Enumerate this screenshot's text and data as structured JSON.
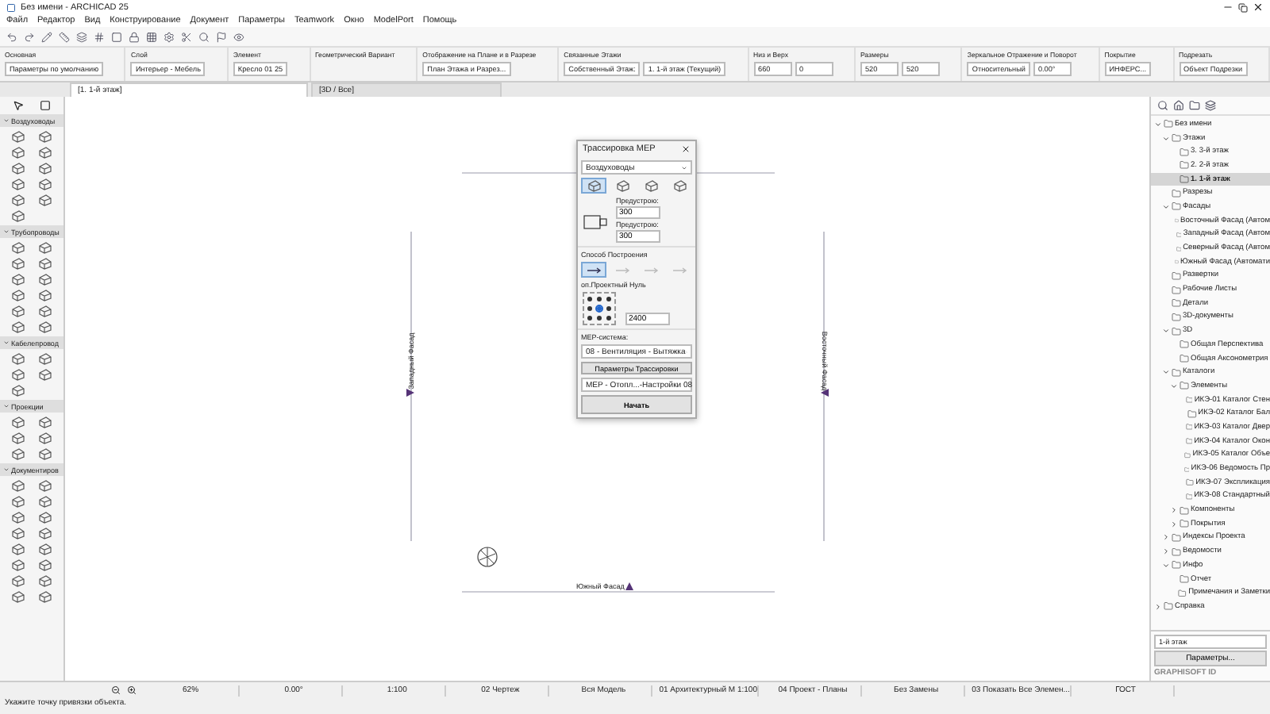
{
  "window": {
    "title": "Без имени - ARCHICAD 25"
  },
  "menu": [
    "Файл",
    "Редактор",
    "Вид",
    "Конструирование",
    "Документ",
    "Параметры",
    "Teamwork",
    "Окно",
    "ModelPort",
    "Помощь"
  ],
  "info_box": [
    {
      "label": "Основная",
      "values": [
        "Параметры по умолчанию"
      ]
    },
    {
      "label": "Слой",
      "values": [
        "Интерьер - Мебель"
      ]
    },
    {
      "label": "Элемент",
      "values": [
        "Кресло 01 25"
      ]
    },
    {
      "label": "Геометрический Вариант"
    },
    {
      "label": "Отображение на Плане и в Разрезе",
      "values": [
        "План Этажа и Разрез..."
      ]
    },
    {
      "label": "Связанные Этажи",
      "values": [
        "Собственный Этаж:",
        "1. 1-й этаж (Текущий)"
      ]
    },
    {
      "label": "Низ и Верх",
      "values": [
        "660",
        "0"
      ]
    },
    {
      "label": "Размеры",
      "values": [
        "520",
        "520"
      ]
    },
    {
      "label": "Зеркальное Отражение и Поворот",
      "values": [
        "Относительный",
        "0.00°"
      ]
    },
    {
      "label": "Покрытие",
      "values": [
        "ИНФЕРС..."
      ]
    },
    {
      "label": "Подрезать",
      "values": [
        "Объект Подрезки"
      ]
    }
  ],
  "tabs": [
    {
      "label": "[1. 1-й этаж]",
      "selected": true
    },
    {
      "label": "[3D / Все]",
      "selected": false
    }
  ],
  "toolbox": [
    {
      "title": "Воздуховоды",
      "expanded": true
    },
    {
      "title": "Трубопроводы",
      "expanded": true
    },
    {
      "title": "Кабелепровод",
      "expanded": true
    },
    {
      "title": "Проекции",
      "expanded": true
    },
    {
      "title": "Документиров",
      "expanded": true
    }
  ],
  "canvas": {
    "markers": [
      "Западный Фасад",
      "Восточный Фасад",
      "Южный Фасад"
    ]
  },
  "mep_dialog": {
    "title": "Трассировка MEP",
    "category": "Воздуховоды",
    "shapes": [
      {
        "selected": true
      },
      {
        "selected": false
      },
      {
        "selected": false
      },
      {
        "selected": false
      }
    ],
    "width_label": "Предустрою:",
    "width_value": "300",
    "height_label": "Предустрою:",
    "height_value": "300",
    "method_label": "Способ Построения",
    "methods": [
      {
        "selected": true,
        "disabled": false
      },
      {
        "selected": false,
        "disabled": true
      },
      {
        "selected": false,
        "disabled": true
      },
      {
        "selected": false,
        "disabled": true
      }
    ],
    "anchor_label": "оп.Проектный Нуль",
    "anchors": [
      {
        "selected": false
      },
      {
        "selected": false
      },
      {
        "selected": false
      },
      {
        "selected": false
      },
      {
        "selected": true
      },
      {
        "selected": false
      },
      {
        "selected": false
      },
      {
        "selected": false
      },
      {
        "selected": false
      }
    ],
    "elevation_value": "2400",
    "system_label": "MEP-система:",
    "system_value": "08 - Вентиляция - Вытяжка",
    "settings_button": "Параметры Трассировки",
    "preset_value": "MEP - Отопл...-Настройки 08",
    "start_button": "Начать"
  },
  "navigator": [
    {
      "label": "Без имени",
      "expanded": true,
      "selected": false,
      "children": [
        {
          "label": "Этажи",
          "expanded": true,
          "selected": false,
          "children": [
            {
              "label": "3. 3-й этаж",
              "selected": false
            },
            {
              "label": "2. 2-й этаж",
              "selected": false
            },
            {
              "label": "1. 1-й этаж",
              "selected": true
            }
          ]
        },
        {
          "label": "Разрезы",
          "selected": false
        },
        {
          "label": "Фасады",
          "expanded": true,
          "selected": false,
          "children": [
            {
              "label": "Восточный Фасад (Автом",
              "selected": false
            },
            {
              "label": "Западный Фасад (Автом",
              "selected": false
            },
            {
              "label": "Северный Фасад (Автом",
              "selected": false
            },
            {
              "label": "Южный Фасад (Автомати",
              "selected": false
            }
          ]
        },
        {
          "label": "Развертки",
          "selected": false
        },
        {
          "label": "Рабочие Листы",
          "selected": false
        },
        {
          "label": "Детали",
          "selected": false
        },
        {
          "label": "3D-документы",
          "selected": false
        },
        {
          "label": "3D",
          "expanded": true,
          "selected": false,
          "children": [
            {
              "label": "Общая Перспектива",
              "selected": false
            },
            {
              "label": "Общая Аксонометрия",
              "selected": false
            }
          ]
        },
        {
          "label": "Каталоги",
          "expanded": true,
          "selected": false,
          "children": [
            {
              "label": "Элементы",
              "expanded": true,
              "selected": false,
              "children": [
                {
                  "label": "ИКЭ-01 Каталог Стен",
                  "selected": false
                },
                {
                  "label": "ИКЭ-02 Каталог Бал",
                  "selected": false
                },
                {
                  "label": "ИКЭ-03 Каталог Двер",
                  "selected": false
                },
                {
                  "label": "ИКЭ-04 Каталог Окон",
                  "selected": false
                },
                {
                  "label": "ИКЭ-05 Каталог Объе",
                  "selected": false
                },
                {
                  "label": "ИКЭ-06 Ведомость Пр",
                  "selected": false
                },
                {
                  "label": "ИКЭ-07 Экспликация",
                  "selected": false
                },
                {
                  "label": "ИКЭ-08 Стандартный",
                  "selected": false
                }
              ]
            },
            {
              "label": "Компоненты",
              "expanded": false,
              "selected": false
            },
            {
              "label": "Покрытия",
              "expanded": false,
              "selected": false
            }
          ]
        },
        {
          "label": "Индексы Проекта",
          "expanded": false,
          "selected": false
        },
        {
          "label": "Ведомости",
          "expanded": false,
          "selected": false
        },
        {
          "label": "Инфо",
          "expanded": true,
          "selected": false,
          "children": [
            {
              "label": "Отчет",
              "selected": false
            },
            {
              "label": "Примечания и Заметки",
              "selected": false
            }
          ]
        }
      ]
    },
    {
      "label": "Справка",
      "expanded": false,
      "selected": false
    }
  ],
  "navigator_footer": {
    "floor": "1-й этаж",
    "button": "Параметры...",
    "brand": "GRAPHISOFT ID"
  },
  "status_bar": {
    "controls": [
      "62%",
      "0.00°",
      "1:100",
      "02 Чертеж",
      "Вся Модель",
      "01 Архитектурный М 1:100",
      "04 Проект - Планы",
      "Без Замены",
      "03 Показать Все Элемен...",
      "ГОСТ"
    ],
    "message": "Укажите точку привязки объекта."
  }
}
